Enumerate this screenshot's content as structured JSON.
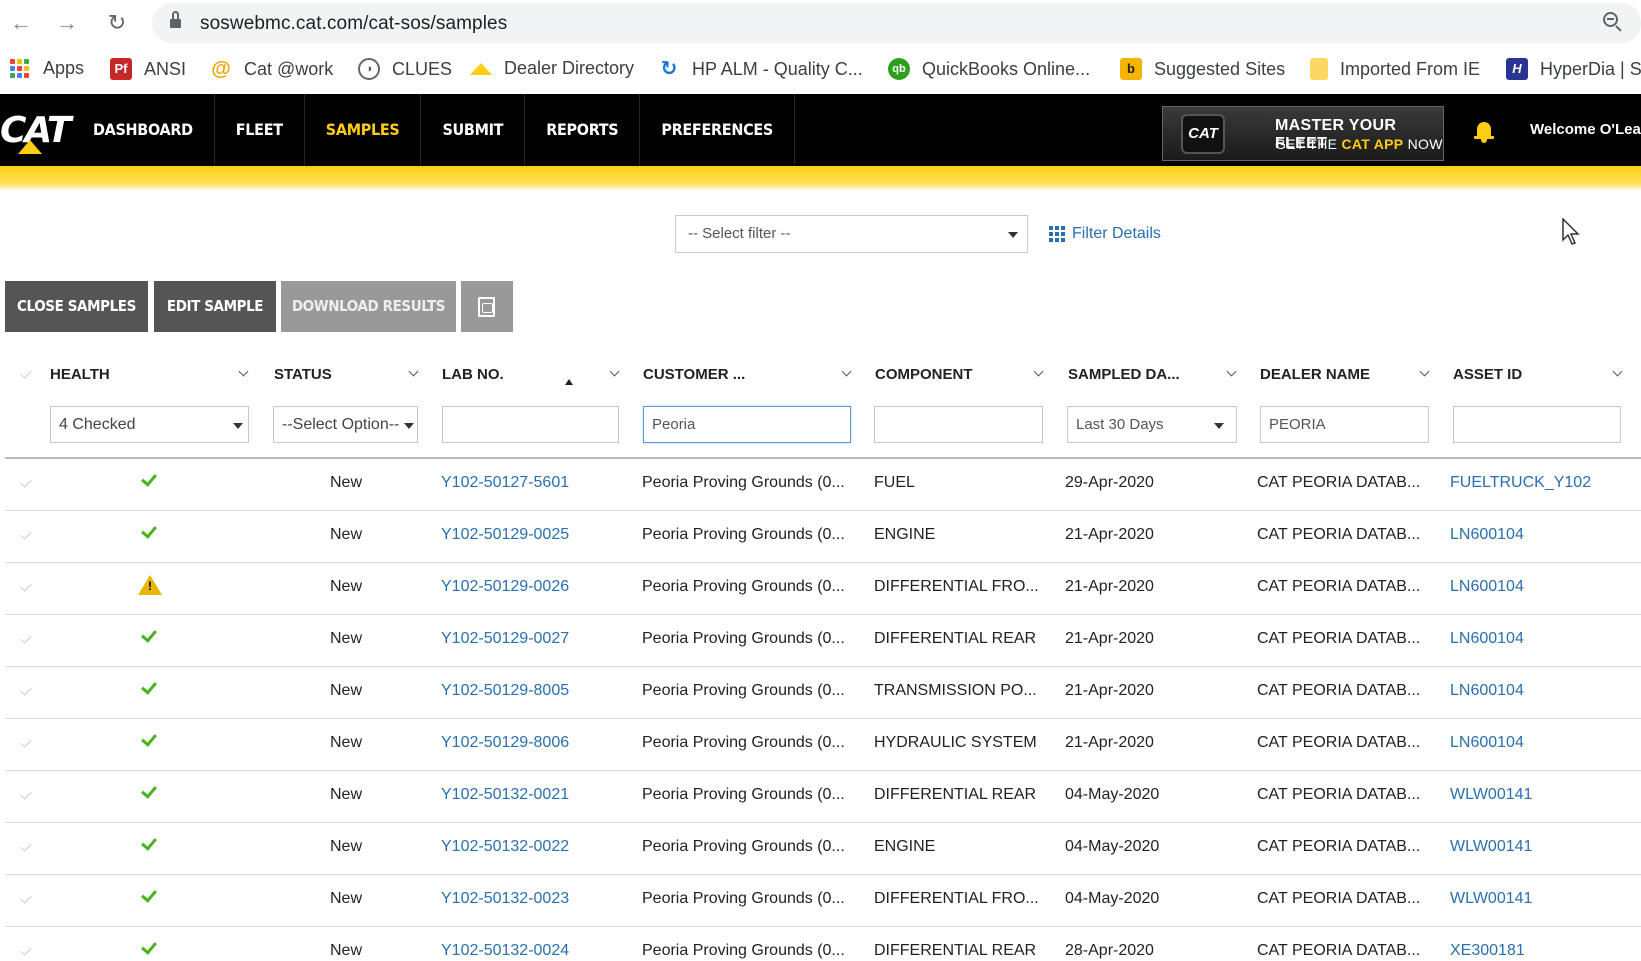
{
  "browser": {
    "url": "soswebmc.cat.com/cat-sos/samples",
    "bookmarks": [
      {
        "label": "Apps",
        "icon": "apps-grid-icon"
      },
      {
        "label": "ANSI",
        "icon": "pdf-icon"
      },
      {
        "label": "Cat @work",
        "icon": "at-icon"
      },
      {
        "label": "CLUES",
        "icon": "clues-icon"
      },
      {
        "label": "Dealer Directory",
        "icon": "cat-triangle-icon"
      },
      {
        "label": "HP ALM - Quality C...",
        "icon": "refresh-icon"
      },
      {
        "label": "QuickBooks Online...",
        "icon": "qb-icon"
      },
      {
        "label": "Suggested Sites",
        "icon": "bing-icon"
      },
      {
        "label": "Imported From IE",
        "icon": "folder-icon"
      },
      {
        "label": "HyperDia | S",
        "icon": "hd-icon"
      }
    ]
  },
  "header": {
    "logo": "CAT",
    "nav": [
      {
        "label": "DASHBOARD",
        "active": false
      },
      {
        "label": "FLEET",
        "active": false
      },
      {
        "label": "SAMPLES",
        "active": true
      },
      {
        "label": "SUBMIT",
        "active": false
      },
      {
        "label": "REPORTS",
        "active": false
      },
      {
        "label": "PREFERENCES",
        "active": false
      }
    ],
    "banner": {
      "badge": "CAT",
      "line1": "MASTER YOUR FLEET",
      "line2_pre": "GET THE ",
      "line2_brand": "CAT APP",
      "line2_post": " NOW"
    },
    "welcome": "Welcome O'Lea"
  },
  "filter": {
    "select_placeholder": "-- Select filter --",
    "details_label": "Filter Details"
  },
  "actions": {
    "close": "CLOSE SAMPLES",
    "edit": "EDIT SAMPLE",
    "download": "DOWNLOAD RESULTS"
  },
  "columns": [
    {
      "label": "HEALTH",
      "filter": "4 Checked",
      "filter_type": "dropdown"
    },
    {
      "label": "STATUS",
      "filter": "--Select Option--",
      "filter_type": "dropdown"
    },
    {
      "label": "LAB NO.",
      "filter": "",
      "filter_type": "text"
    },
    {
      "label": "CUSTOMER ...",
      "filter": "Peoria",
      "filter_type": "text"
    },
    {
      "label": "COMPONENT",
      "filter": "",
      "filter_type": "text"
    },
    {
      "label": "SAMPLED DA...",
      "filter": "Last 30 Days",
      "filter_type": "dropdown"
    },
    {
      "label": "DEALER NAME",
      "filter": "PEORIA",
      "filter_type": "text"
    },
    {
      "label": "ASSET ID",
      "filter": "",
      "filter_type": "text"
    }
  ],
  "rows": [
    {
      "health": "ok",
      "status": "New",
      "lab": "Y102-50127-5601",
      "customer": "Peoria Proving Grounds (0...",
      "component": "FUEL",
      "date": "29-Apr-2020",
      "dealer": "CAT PEORIA DATAB...",
      "asset": "FUELTRUCK_Y102"
    },
    {
      "health": "ok",
      "status": "New",
      "lab": "Y102-50129-0025",
      "customer": "Peoria Proving Grounds (0...",
      "component": "ENGINE",
      "date": "21-Apr-2020",
      "dealer": "CAT PEORIA DATAB...",
      "asset": "LN600104"
    },
    {
      "health": "warning",
      "status": "New",
      "lab": "Y102-50129-0026",
      "customer": "Peoria Proving Grounds (0...",
      "component": "DIFFERENTIAL FRO...",
      "date": "21-Apr-2020",
      "dealer": "CAT PEORIA DATAB...",
      "asset": "LN600104"
    },
    {
      "health": "ok",
      "status": "New",
      "lab": "Y102-50129-0027",
      "customer": "Peoria Proving Grounds (0...",
      "component": "DIFFERENTIAL REAR",
      "date": "21-Apr-2020",
      "dealer": "CAT PEORIA DATAB...",
      "asset": "LN600104"
    },
    {
      "health": "ok",
      "status": "New",
      "lab": "Y102-50129-8005",
      "customer": "Peoria Proving Grounds (0...",
      "component": "TRANSMISSION PO...",
      "date": "21-Apr-2020",
      "dealer": "CAT PEORIA DATAB...",
      "asset": "LN600104"
    },
    {
      "health": "ok",
      "status": "New",
      "lab": "Y102-50129-8006",
      "customer": "Peoria Proving Grounds (0...",
      "component": "HYDRAULIC SYSTEM",
      "date": "21-Apr-2020",
      "dealer": "CAT PEORIA DATAB...",
      "asset": "LN600104"
    },
    {
      "health": "ok",
      "status": "New",
      "lab": "Y102-50132-0021",
      "customer": "Peoria Proving Grounds (0...",
      "component": "DIFFERENTIAL REAR",
      "date": "04-May-2020",
      "dealer": "CAT PEORIA DATAB...",
      "asset": "WLW00141"
    },
    {
      "health": "ok",
      "status": "New",
      "lab": "Y102-50132-0022",
      "customer": "Peoria Proving Grounds (0...",
      "component": "ENGINE",
      "date": "04-May-2020",
      "dealer": "CAT PEORIA DATAB...",
      "asset": "WLW00141"
    },
    {
      "health": "ok",
      "status": "New",
      "lab": "Y102-50132-0023",
      "customer": "Peoria Proving Grounds (0...",
      "component": "DIFFERENTIAL FRO...",
      "date": "04-May-2020",
      "dealer": "CAT PEORIA DATAB...",
      "asset": "WLW00141"
    },
    {
      "health": "ok",
      "status": "New",
      "lab": "Y102-50132-0024",
      "customer": "Peoria Proving Grounds (0...",
      "component": "DIFFERENTIAL REAR",
      "date": "28-Apr-2020",
      "dealer": "CAT PEORIA DATAB...",
      "asset": "XE300181"
    }
  ],
  "colors": {
    "brand_yellow": "#ffcd11",
    "link_blue": "#2a6fb0",
    "ok_green": "#4caf1d",
    "warn_yellow": "#e6b800"
  }
}
